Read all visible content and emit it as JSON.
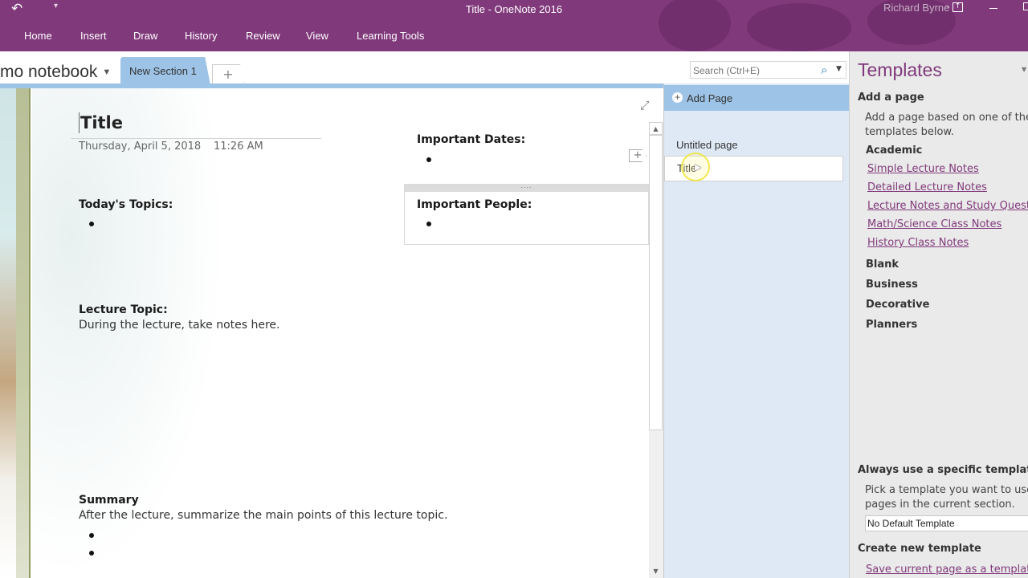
{
  "titlebar": {
    "window_title": "Title  -  OneNote 2016",
    "user_name": "Richard Byrne",
    "undo_icon": "undo-icon",
    "qat_icon": "customize-quick-access-icon"
  },
  "ribbon": {
    "tabs": [
      {
        "label": "Home"
      },
      {
        "label": "Insert"
      },
      {
        "label": "Draw"
      },
      {
        "label": "History"
      },
      {
        "label": "Review"
      },
      {
        "label": "View"
      },
      {
        "label": "Learning Tools"
      }
    ]
  },
  "navbar": {
    "notebook_name": "mo notebook",
    "section_tab": "New Section 1",
    "add_section": "+",
    "search_placeholder": "Search (Ctrl+E)"
  },
  "page": {
    "title": "Title",
    "date": "Thursday, April 5, 2018",
    "time": "11:26 AM",
    "todays_topics": "Today's Topics:",
    "important_dates": "Important Dates:",
    "important_people": "Important People:",
    "lecture_topic": "Lecture Topic:",
    "lecture_text": "During the lecture, take notes here.",
    "summary": "Summary",
    "summary_text": "After the lecture, summarize the main points of this lecture topic."
  },
  "page_list": {
    "add_page": "Add Page",
    "pages": [
      {
        "label": "Untitled page",
        "selected": false
      },
      {
        "label": "Title",
        "selected": true
      }
    ]
  },
  "templates": {
    "title": "Templates",
    "add_a_page": "Add a page",
    "add_desc_1": "Add a page based on one of the",
    "add_desc_2": "templates below.",
    "academic": "Academic",
    "academic_links": [
      "Simple Lecture Notes",
      "Detailed Lecture Notes",
      "Lecture Notes and Study Questions",
      "Math/Science Class Notes",
      "History Class Notes"
    ],
    "categories": [
      "Blank",
      "Business",
      "Decorative",
      "Planners"
    ],
    "always_use": "Always use a specific template",
    "pick_desc_1": "Pick a template you want to use for",
    "pick_desc_2": "pages in the current section.",
    "default_template": "No Default Template",
    "create_new": "Create new template",
    "save_current": "Save current page as a template"
  },
  "colors": {
    "brand_purple": "#80397b",
    "section_blue": "#9dc3e6",
    "page_list_bg": "#dfe9f5",
    "templates_bg": "#eaeaea"
  }
}
